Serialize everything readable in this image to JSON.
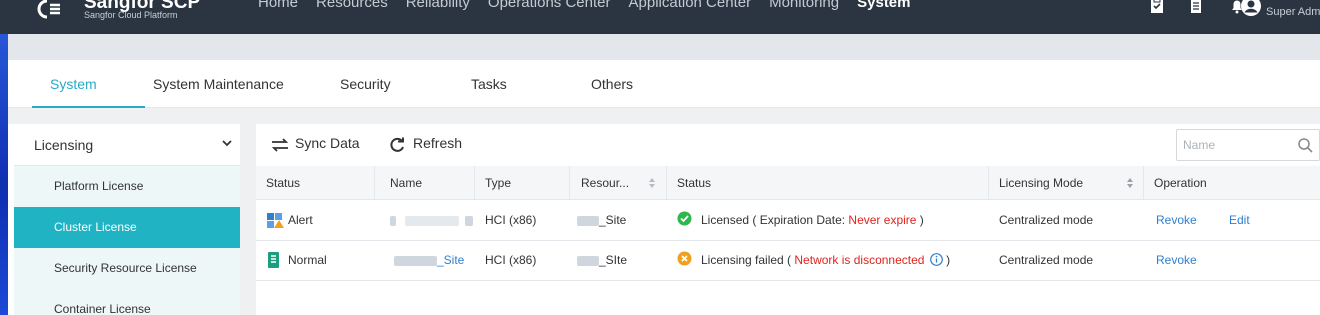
{
  "brand": {
    "name": "Sangfor SCP",
    "subtitle": "Sangfor Cloud Platform"
  },
  "nav": {
    "items": [
      {
        "label": "Home"
      },
      {
        "label": "Resources"
      },
      {
        "label": "Reliability"
      },
      {
        "label": "Operations Center"
      },
      {
        "label": "Application Center"
      },
      {
        "label": "Monitoring"
      },
      {
        "label": "System"
      }
    ],
    "active": "System"
  },
  "top_icons": [
    "clipboard-icon",
    "document-icon",
    "bell-icon",
    "user-avatar-icon"
  ],
  "user": {
    "name": "Super Admi"
  },
  "tabs": [
    {
      "label": "System"
    },
    {
      "label": "System Maintenance"
    },
    {
      "label": "Security"
    },
    {
      "label": "Tasks"
    },
    {
      "label": "Others"
    }
  ],
  "sidebar": {
    "header": "Licensing",
    "items": [
      {
        "label": "Platform License"
      },
      {
        "label": "Cluster License"
      },
      {
        "label": "Security Resource License"
      },
      {
        "label": "Container License"
      }
    ]
  },
  "toolbar": {
    "sync_label": "Sync Data",
    "refresh_label": "Refresh",
    "search_placeholder": "Name"
  },
  "table": {
    "columns": [
      "Status",
      "Name",
      "Type",
      "Resour...",
      "Status",
      "Licensing Mode",
      "Operation"
    ],
    "rows": [
      {
        "status": "Alert",
        "name_suffix": "",
        "type": "HCI (x86)",
        "resource_suffix": "_Site",
        "license_text": "Licensed ( Expiration Date: ",
        "license_detail": "Never expire",
        "license_close": " )",
        "mode": "Centralized mode",
        "ops": [
          "Revoke",
          "Edit"
        ]
      },
      {
        "status": "Normal",
        "name_suffix": "_Site",
        "type": "HCI (x86)",
        "resource_suffix": "_SIte",
        "license_text": "Licensing failed ( ",
        "license_detail": "Network is disconnected",
        "license_close": " )",
        "mode": "Centralized mode",
        "ops": [
          "Revoke"
        ]
      }
    ]
  },
  "colors": {
    "accent": "#2aa9c7",
    "sidebar_active": "#1fb3c4",
    "link": "#2f7fd0",
    "error_text": "#e0231c",
    "ok_green": "#2db84d",
    "warn_orange": "#f0a020",
    "topbar": "#2b3541"
  }
}
